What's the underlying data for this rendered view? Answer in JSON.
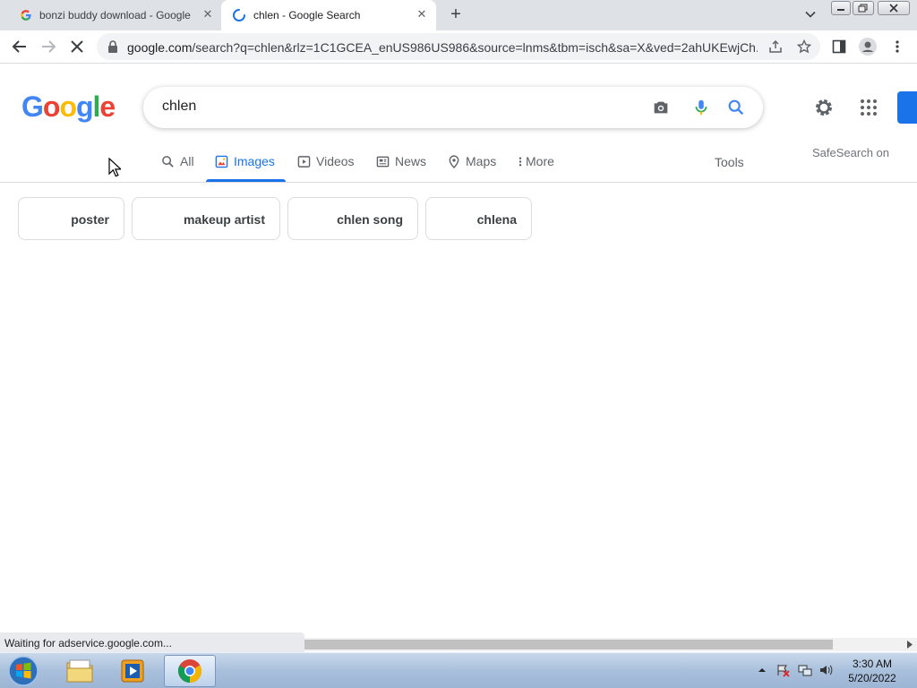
{
  "browser": {
    "tabs": [
      {
        "title": "bonzi buddy download - Google",
        "close": "✕",
        "favicon": "google-g-icon"
      },
      {
        "title": "chlen - Google Search",
        "close": "✕",
        "favicon": "loading-spinner-icon"
      }
    ],
    "new_tab": "+",
    "url_host": "google.com",
    "url_rest": "/search?q=chlen&rlz=1C1GCEA_enUS986US986&source=lnms&tbm=isch&sa=X&ved=2ahUKEwjCh..."
  },
  "google": {
    "logo_letters": [
      "G",
      "o",
      "o",
      "g",
      "l",
      "e"
    ],
    "logo_colors": [
      "#4285f4",
      "#ea4335",
      "#fbbc05",
      "#4285f4",
      "#34a853",
      "#ea4335"
    ],
    "search_query": "chlen",
    "nav_tabs": [
      {
        "label": "All",
        "icon": "search-icon"
      },
      {
        "label": "Images",
        "icon": "image-icon",
        "active": true
      },
      {
        "label": "Videos",
        "icon": "play-icon"
      },
      {
        "label": "News",
        "icon": "news-icon"
      },
      {
        "label": "Maps",
        "icon": "map-pin-icon"
      },
      {
        "label": "More",
        "icon": "more-vert-icon"
      }
    ],
    "tools": "Tools",
    "safesearch": "SafeSearch on",
    "chips": [
      "poster",
      "makeup artist",
      "chlen song",
      "chlena"
    ]
  },
  "status": {
    "text": "Waiting for adservice.google.com..."
  },
  "taskbar": {
    "time": "3:30 AM",
    "date": "5/20/2022"
  },
  "colors": {
    "accent": "#1a73e8",
    "taskbar": "#a9c0dc"
  }
}
